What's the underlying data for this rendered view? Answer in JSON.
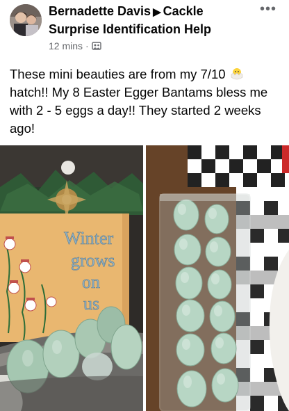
{
  "post": {
    "author": "Bernadette Davis",
    "group": "Cackle Surprise Identification Help",
    "time": "12 mins",
    "audience_icon": "group-audience-icon",
    "more_icon": "more-options-icon",
    "text_part1": "These mini beauties are from my 7/10",
    "text_part2": "hatch!! My 8 Easter Egger Bantams bless me with 2 - 5 eggs a day!! They started 2 weeks ago!",
    "emoji": "hatching-chick-icon"
  },
  "photos": {
    "left": {
      "sign_text": [
        "Winter",
        "grows",
        "on",
        "us"
      ]
    },
    "right": {}
  },
  "colors": {
    "egg": "#a9c8b2",
    "sign": "#e9b770",
    "meta": "#65676b"
  }
}
